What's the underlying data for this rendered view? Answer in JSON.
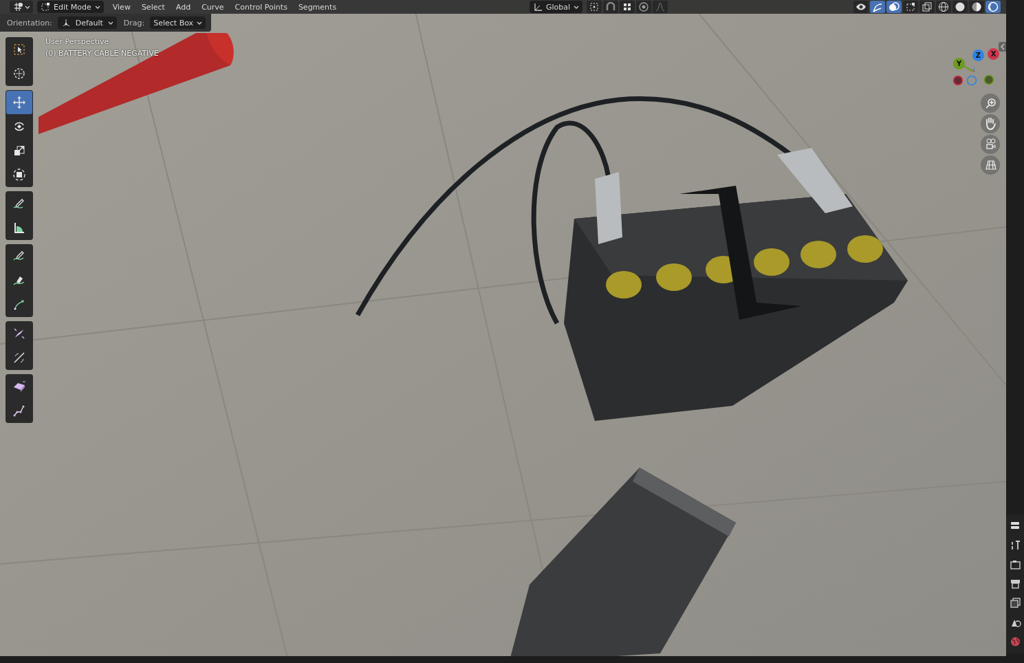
{
  "header": {
    "mode": "Edit Mode",
    "menus": [
      "View",
      "Select",
      "Add",
      "Curve",
      "Control Points",
      "Segments"
    ],
    "orientation": "Global",
    "center_tools": [
      {
        "kind": "pivot",
        "selected": false
      },
      {
        "kind": "snap",
        "selected": false
      },
      {
        "kind": "snap-target",
        "selected": false
      },
      {
        "kind": "proportional",
        "selected": false
      },
      {
        "kind": "falloff",
        "selected": false
      }
    ],
    "right_tools": [
      {
        "kind": "visibility",
        "selected": false
      },
      {
        "kind": "gizmo",
        "selected": true
      },
      {
        "kind": "overlay",
        "selected": true
      },
      {
        "kind": "handles",
        "selected": false
      },
      {
        "kind": "xray",
        "selected": false
      },
      {
        "kind": "wireframe",
        "selected": false
      },
      {
        "kind": "solid",
        "selected": false
      },
      {
        "kind": "material",
        "selected": false
      },
      {
        "kind": "rendered",
        "selected": true
      }
    ]
  },
  "tool_settings": {
    "orientation_label": "Orientation:",
    "orientation_value": "Default",
    "drag_label": "Drag:",
    "drag_value": "Select Box"
  },
  "viewport": {
    "view_name": "User Perspective",
    "object_name": "(0) BATTERY CABLE NEGATIVE"
  },
  "toolbar": [
    [
      {
        "kind": "select-box",
        "selected": false
      },
      {
        "kind": "cursor",
        "selected": false
      }
    ],
    [
      {
        "kind": "move",
        "selected": true
      },
      {
        "kind": "rotate",
        "selected": false
      },
      {
        "kind": "scale",
        "selected": false
      },
      {
        "kind": "transform",
        "selected": false
      }
    ],
    [
      {
        "kind": "annotate",
        "selected": false
      },
      {
        "kind": "measure",
        "selected": false
      }
    ],
    [
      {
        "kind": "draw",
        "selected": false
      },
      {
        "kind": "pen",
        "selected": false
      },
      {
        "kind": "extrude",
        "selected": false
      }
    ],
    [
      {
        "kind": "radius",
        "selected": false
      },
      {
        "kind": "tilt",
        "selected": false
      }
    ],
    [
      {
        "kind": "randomize",
        "selected": false
      },
      {
        "kind": "vertex",
        "selected": false
      }
    ]
  ],
  "nav_gizmo": {
    "axes": [
      {
        "label": "Y",
        "color": "#6e9a1f"
      },
      {
        "label": "Z",
        "color": "#2f83e3"
      },
      {
        "label": "X",
        "color": "#d0354d"
      }
    ]
  },
  "nav_buttons": [
    {
      "kind": "zoom"
    },
    {
      "kind": "pan"
    },
    {
      "kind": "camera"
    },
    {
      "kind": "ortho"
    }
  ],
  "properties_tabs": [
    {
      "kind": "tool",
      "selected": false
    },
    {
      "kind": "render",
      "selected": false
    },
    {
      "kind": "output",
      "selected": false
    },
    {
      "kind": "view-layer",
      "selected": false
    },
    {
      "kind": "scene",
      "selected": false
    },
    {
      "kind": "world",
      "selected": false
    }
  ]
}
